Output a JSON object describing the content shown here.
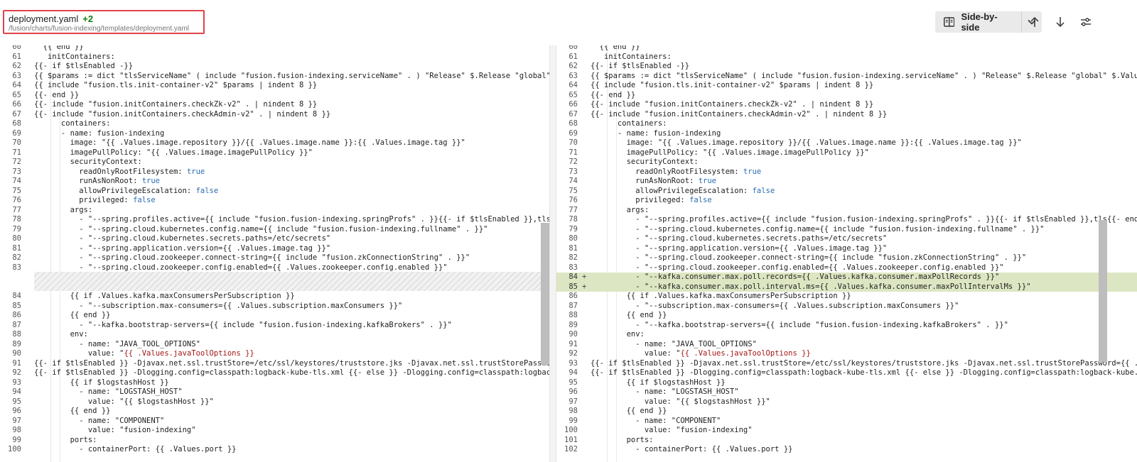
{
  "header": {
    "file_name": "deployment.yaml",
    "change_count": "+2",
    "file_path": "/fusion/charts/fusion-indexing/templates/deployment.yaml",
    "view_mode": "Side-by-side"
  },
  "left_lines": [
    {
      "n": "60",
      "t": "  {{ end }}"
    },
    {
      "n": "61",
      "t": "   initContainers:"
    },
    {
      "n": "62",
      "t": "{{- if $tlsEnabled -}}"
    },
    {
      "n": "63",
      "t": "{{ $params := dict \"tlsServiceName\" ( include \"fusion.fusion-indexing.serviceName\" . ) \"Release\" $.Release \"global\" $.Values.global }}"
    },
    {
      "n": "64",
      "t": "{{ include \"fusion.tls.init-container-v2\" $params | indent 8 }}"
    },
    {
      "n": "65",
      "t": "{{- end }}"
    },
    {
      "n": "66",
      "t": "{{- include \"fusion.initContainers.checkZk-v2\" . | nindent 8 }}"
    },
    {
      "n": "67",
      "t": "{{- include \"fusion.initContainers.checkAdmin-v2\" . | nindent 8 }}"
    },
    {
      "n": "68",
      "t": "      containers:"
    },
    {
      "n": "69",
      "t": "      - name: fusion-indexing"
    },
    {
      "n": "70",
      "t": "        image: \"{{ .Values.image.repository }}/{{ .Values.image.name }}:{{ .Values.image.tag }}\""
    },
    {
      "n": "71",
      "t": "        imagePullPolicy: \"{{ .Values.image.imagePullPolicy }}\""
    },
    {
      "n": "72",
      "t": "        securityContext:"
    },
    {
      "n": "73",
      "t": "          readOnlyRootFilesystem: true"
    },
    {
      "n": "74",
      "t": "          runAsNonRoot: true"
    },
    {
      "n": "75",
      "t": "          allowPrivilegeEscalation: false"
    },
    {
      "n": "76",
      "t": "          privileged: false"
    },
    {
      "n": "77",
      "t": "        args:"
    },
    {
      "n": "78",
      "t": "          - \"--spring.profiles.active={{ include \"fusion.fusion-indexing.springProfs\" . }}{{- if $tlsEnabled }},tls{{- end }}\""
    },
    {
      "n": "79",
      "t": "          - \"--spring.cloud.kubernetes.config.name={{ include \"fusion.fusion-indexing.fullname\" . }}\""
    },
    {
      "n": "80",
      "t": "          - \"--spring.cloud.kubernetes.secrets.paths=/etc/secrets\""
    },
    {
      "n": "81",
      "t": "          - \"--spring.application.version={{ .Values.image.tag }}\""
    },
    {
      "n": "82",
      "t": "          - \"--spring.cloud.zookeeper.connect-string={{ include \"fusion.zkConnectionString\" . }}\""
    },
    {
      "n": "83",
      "t": "          - \"--spring.cloud.zookeeper.config.enabled={{ .Values.zookeeper.config.enabled }}\""
    },
    {
      "n": "84",
      "t": "        {{ if .Values.kafka.maxConsumersPerSubscription }}"
    },
    {
      "n": "85",
      "t": "          - \"--subscription.max-consumers={{ .Values.subscription.maxConsumers }}\""
    },
    {
      "n": "86",
      "t": "        {{ end }}"
    },
    {
      "n": "87",
      "t": "          - \"--kafka.bootstrap-servers={{ include \"fusion.fusion-indexing.kafkaBrokers\" . }}\""
    },
    {
      "n": "88",
      "t": "        env:"
    },
    {
      "n": "89",
      "t": "          - name: \"JAVA_TOOL_OPTIONS\""
    },
    {
      "n": "90",
      "t": "            value: \"{{ .Values.javaToolOptions }}"
    },
    {
      "n": "91",
      "t": "{{- if $tlsEnabled }} -Djavax.net.ssl.trustStore=/etc/ssl/keystores/truststore.jks -Djavax.net.ssl.trustStorePassword={{ .Values.global.tlsPassword }}"
    },
    {
      "n": "92",
      "t": "{{- if $tlsEnabled }} -Dlogging.config=classpath:logback-kube-tls.xml {{- else }} -Dlogging.config=classpath:logback-kube.xml {{- end }}"
    },
    {
      "n": "93",
      "t": "        {{ if $logstashHost }}"
    },
    {
      "n": "94",
      "t": "          - name: \"LOGSTASH_HOST\""
    },
    {
      "n": "95",
      "t": "            value: \"{{ $logstashHost }}\""
    },
    {
      "n": "96",
      "t": "        {{ end }}"
    },
    {
      "n": "97",
      "t": "          - name: \"COMPONENT\""
    },
    {
      "n": "98",
      "t": "            value: \"fusion-indexing\""
    },
    {
      "n": "99",
      "t": "        ports:"
    },
    {
      "n": "100",
      "t": "          - containerPort: {{ .Values.port }}"
    }
  ],
  "right_lines": [
    {
      "n": "60",
      "t": "  {{ end }}",
      "m": ""
    },
    {
      "n": "61",
      "t": "   initContainers:",
      "m": ""
    },
    {
      "n": "62",
      "t": "{{- if $tlsEnabled -}}",
      "m": ""
    },
    {
      "n": "63",
      "t": "{{ $params := dict \"tlsServiceName\" ( include \"fusion.fusion-indexing.serviceName\" . ) \"Release\" $.Release \"global\" $.Values.global }}",
      "m": ""
    },
    {
      "n": "64",
      "t": "{{ include \"fusion.tls.init-container-v2\" $params | indent 8 }}",
      "m": ""
    },
    {
      "n": "65",
      "t": "{{- end }}",
      "m": ""
    },
    {
      "n": "66",
      "t": "{{- include \"fusion.initContainers.checkZk-v2\" . | nindent 8 }}",
      "m": ""
    },
    {
      "n": "67",
      "t": "{{- include \"fusion.initContainers.checkAdmin-v2\" . | nindent 8 }}",
      "m": ""
    },
    {
      "n": "68",
      "t": "      containers:",
      "m": ""
    },
    {
      "n": "69",
      "t": "      - name: fusion-indexing",
      "m": ""
    },
    {
      "n": "70",
      "t": "        image: \"{{ .Values.image.repository }}/{{ .Values.image.name }}:{{ .Values.image.tag }}\"",
      "m": ""
    },
    {
      "n": "71",
      "t": "        imagePullPolicy: \"{{ .Values.image.imagePullPolicy }}\"",
      "m": ""
    },
    {
      "n": "72",
      "t": "        securityContext:",
      "m": ""
    },
    {
      "n": "73",
      "t": "          readOnlyRootFilesystem: true",
      "m": ""
    },
    {
      "n": "74",
      "t": "          runAsNonRoot: true",
      "m": ""
    },
    {
      "n": "75",
      "t": "          allowPrivilegeEscalation: false",
      "m": ""
    },
    {
      "n": "76",
      "t": "          privileged: false",
      "m": ""
    },
    {
      "n": "77",
      "t": "        args:",
      "m": ""
    },
    {
      "n": "78",
      "t": "          - \"--spring.profiles.active={{ include \"fusion.fusion-indexing.springProfs\" . }}{{- if $tlsEnabled }},tls{{- end }}\"",
      "m": ""
    },
    {
      "n": "79",
      "t": "          - \"--spring.cloud.kubernetes.config.name={{ include \"fusion.fusion-indexing.fullname\" . }}\"",
      "m": ""
    },
    {
      "n": "80",
      "t": "          - \"--spring.cloud.kubernetes.secrets.paths=/etc/secrets\"",
      "m": ""
    },
    {
      "n": "81",
      "t": "          - \"--spring.application.version={{ .Values.image.tag }}\"",
      "m": ""
    },
    {
      "n": "82",
      "t": "          - \"--spring.cloud.zookeeper.connect-string={{ include \"fusion.zkConnectionString\" . }}\"",
      "m": ""
    },
    {
      "n": "83",
      "t": "          - \"--spring.cloud.zookeeper.config.enabled={{ .Values.zookeeper.config.enabled }}\"",
      "m": ""
    },
    {
      "n": "84",
      "t": "          - \"--kafka.consumer.max.poll.records={{ .Values.kafka.consumer.maxPollRecords }}\"",
      "m": "+"
    },
    {
      "n": "85",
      "t": "          - \"--kafka.consumer.max.poll.interval.ms={{ .Values.kafka.consumer.maxPollIntervalMs }}\"",
      "m": "+"
    },
    {
      "n": "86",
      "t": "        {{ if .Values.kafka.maxConsumersPerSubscription }}",
      "m": ""
    },
    {
      "n": "87",
      "t": "          - \"--subscription.max-consumers={{ .Values.subscription.maxConsumers }}\"",
      "m": ""
    },
    {
      "n": "88",
      "t": "        {{ end }}",
      "m": ""
    },
    {
      "n": "89",
      "t": "          - \"--kafka.bootstrap-servers={{ include \"fusion.fusion-indexing.kafkaBrokers\" . }}\"",
      "m": ""
    },
    {
      "n": "90",
      "t": "        env:",
      "m": ""
    },
    {
      "n": "91",
      "t": "          - name: \"JAVA_TOOL_OPTIONS\"",
      "m": ""
    },
    {
      "n": "92",
      "t": "            value: \"{{ .Values.javaToolOptions }}",
      "m": ""
    },
    {
      "n": "93",
      "t": "{{- if $tlsEnabled }} -Djavax.net.ssl.trustStore=/etc/ssl/keystores/truststore.jks -Djavax.net.ssl.trustStorePassword={{ .Values.global.tlsPassword }}",
      "m": ""
    },
    {
      "n": "94",
      "t": "{{- if $tlsEnabled }} -Dlogging.config=classpath:logback-kube-tls.xml {{- else }} -Dlogging.config=classpath:logback-kube.xml {{- end }}",
      "m": ""
    },
    {
      "n": "95",
      "t": "        {{ if $logstashHost }}",
      "m": ""
    },
    {
      "n": "96",
      "t": "          - name: \"LOGSTASH_HOST\"",
      "m": ""
    },
    {
      "n": "97",
      "t": "            value: \"{{ $logstashHost }}\"",
      "m": ""
    },
    {
      "n": "98",
      "t": "        {{ end }}",
      "m": ""
    },
    {
      "n": "99",
      "t": "          - name: \"COMPONENT\"",
      "m": ""
    },
    {
      "n": "100",
      "t": "            value: \"fusion-indexing\"",
      "m": ""
    },
    {
      "n": "101",
      "t": "        ports:",
      "m": ""
    },
    {
      "n": "102",
      "t": "          - containerPort: {{ .Values.port }}",
      "m": ""
    }
  ],
  "colors": {
    "added_bg": "#dde6c2",
    "keyword": "#2b6cb0",
    "string_red": "#a31515",
    "highlight_border": "#e2424a",
    "count_green": "#107c10"
  },
  "icons": [
    "side-by-side-icon",
    "chevron-down-icon",
    "arrow-up-icon",
    "arrow-down-icon",
    "settings-sliders-icon"
  ]
}
